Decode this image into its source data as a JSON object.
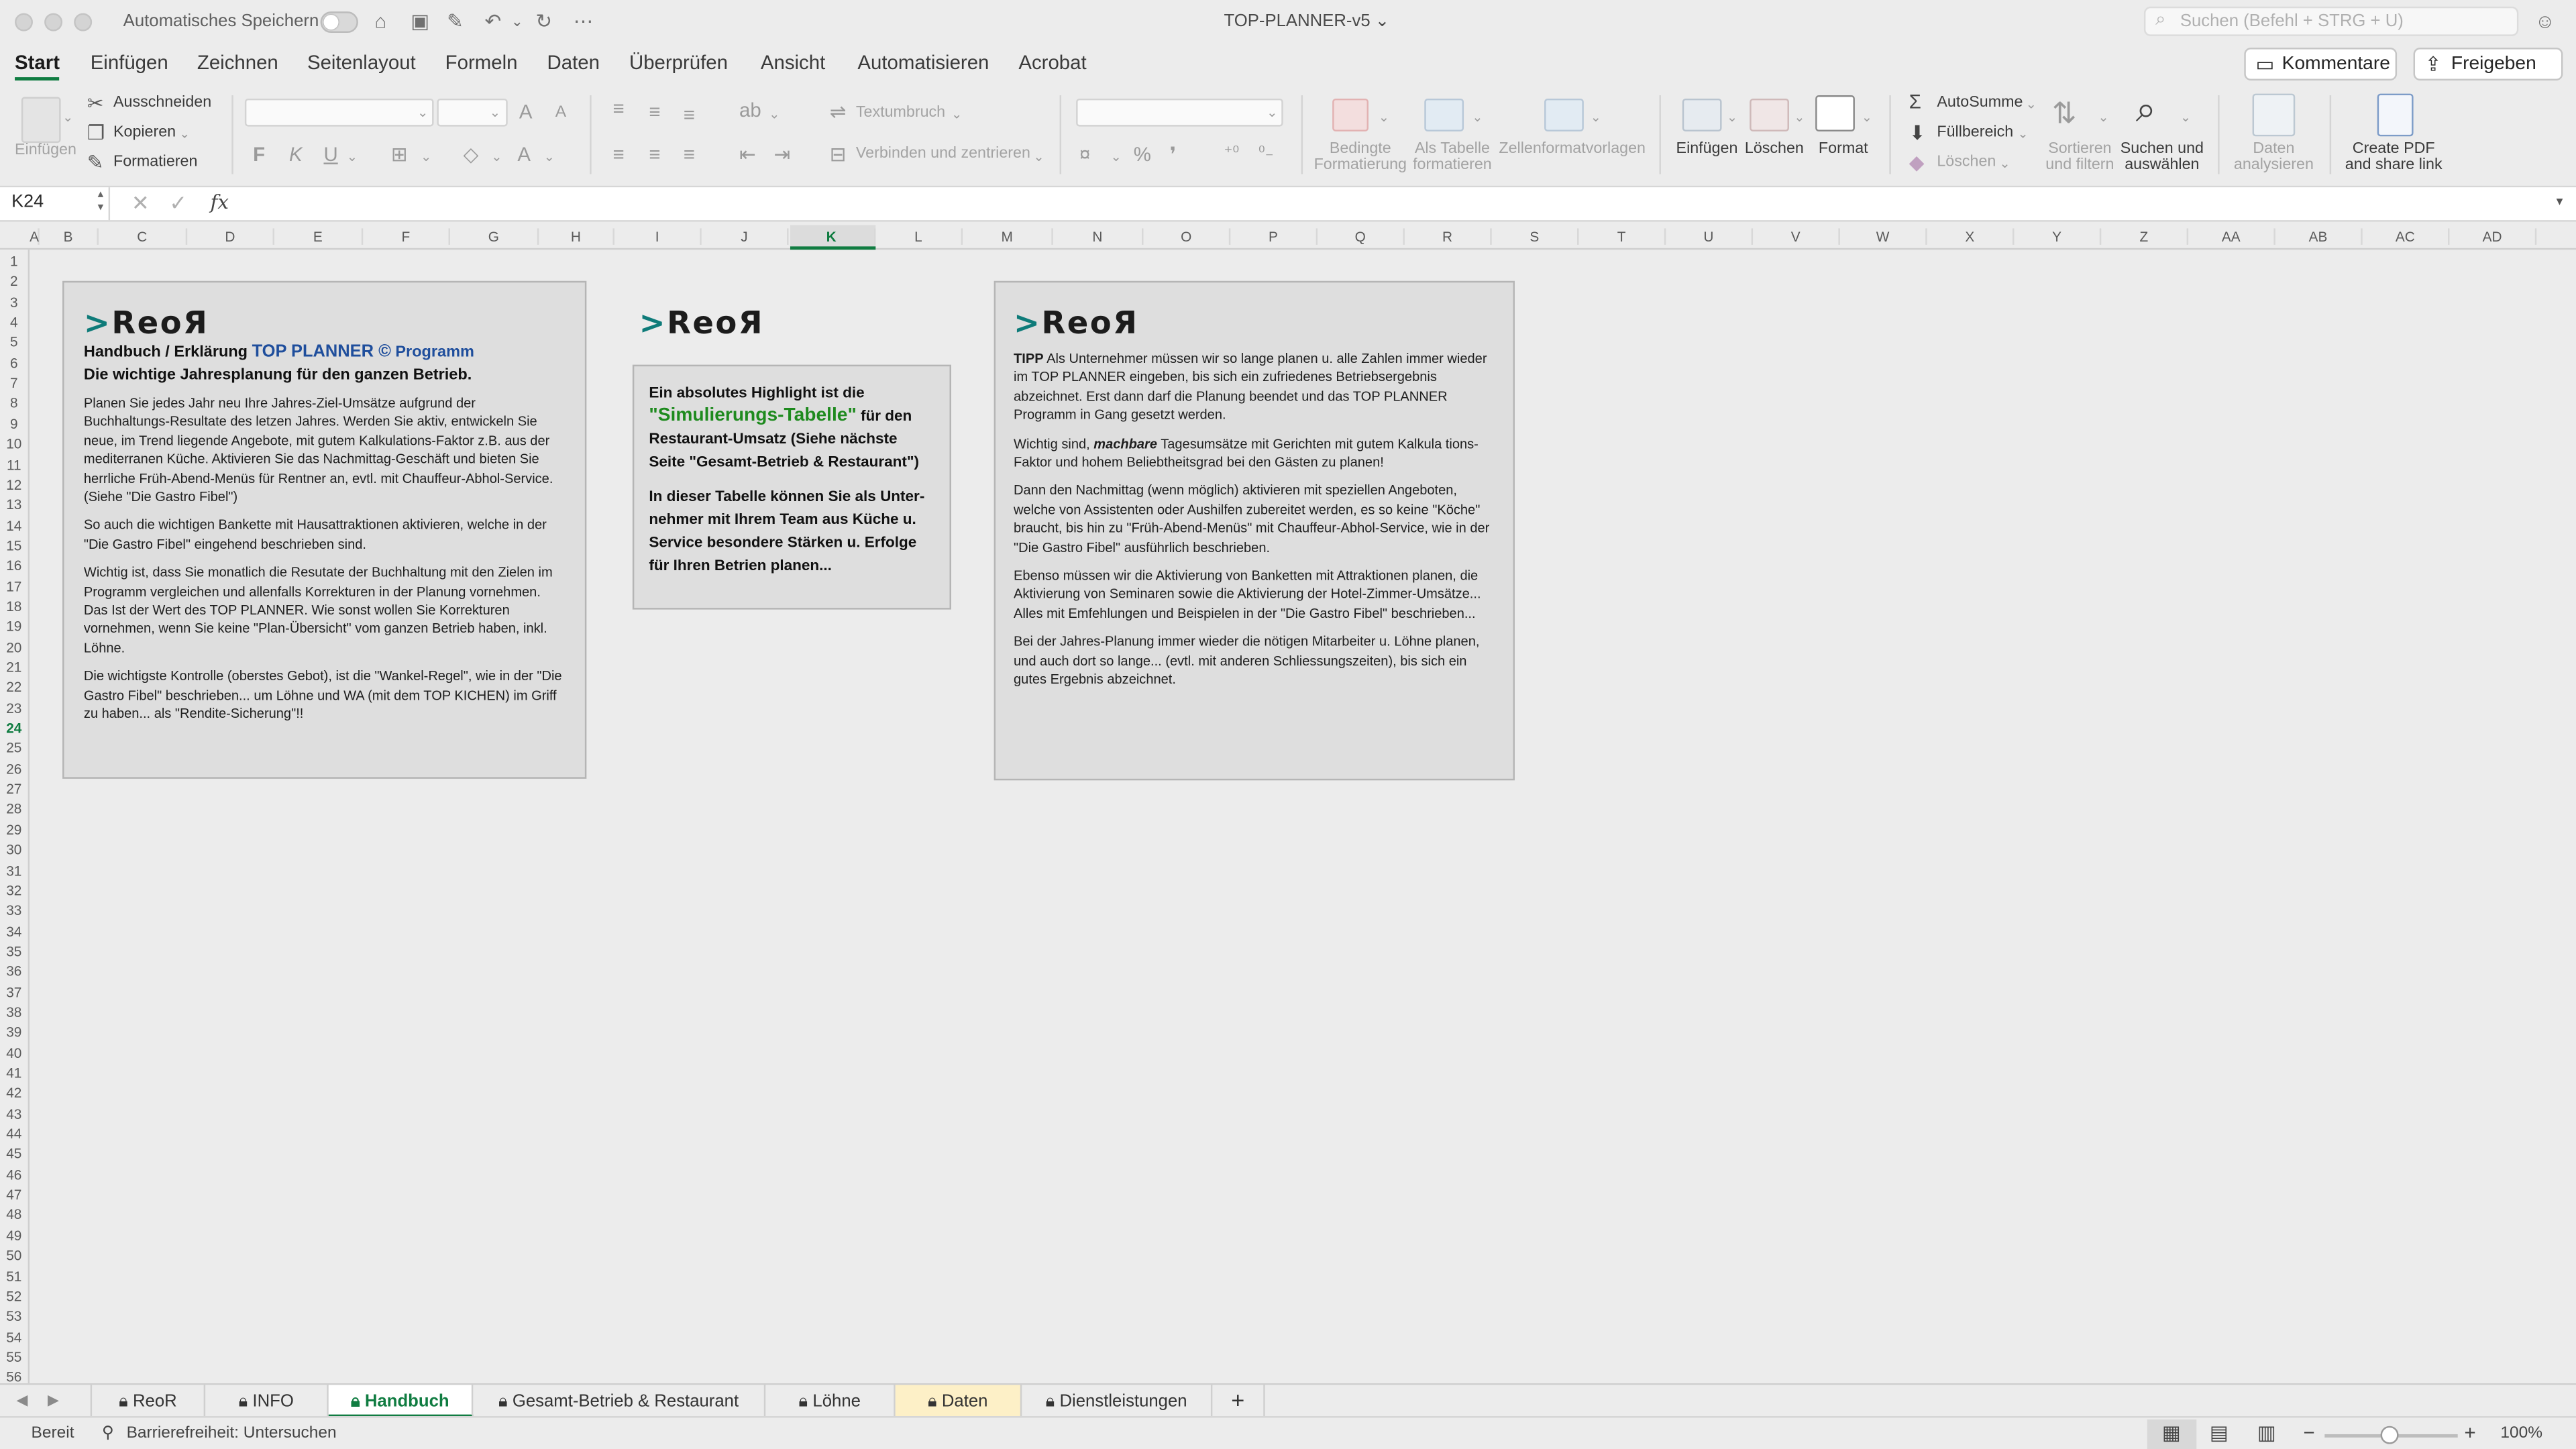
{
  "titlebar": {
    "autosave_label": "Automatisches Speichern",
    "doc_title": "TOP-PLANNER-v5",
    "search_placeholder": "Suchen (Befehl + STRG + U)"
  },
  "tabs": [
    "Start",
    "Einfügen",
    "Zeichnen",
    "Seitenlayout",
    "Formeln",
    "Daten",
    "Überprüfen",
    "Ansicht",
    "Automatisieren",
    "Acrobat"
  ],
  "header_buttons": {
    "comments": "Kommentare",
    "share": "Freigeben"
  },
  "ribbon": {
    "paste": "Einfügen",
    "cut": "Ausschneiden",
    "copy": "Kopieren",
    "format_painter": "Formatieren",
    "bold": "F",
    "italic": "K",
    "underline": "U",
    "wrap_text": "Textumbruch",
    "merge_center": "Verbinden und zentrieren",
    "cond_format_1": "Bedingte",
    "cond_format_2": "Formatierung",
    "as_table_1": "Als Tabelle",
    "as_table_2": "formatieren",
    "cell_styles": "Zellenformatvorlagen",
    "insert": "Einfügen",
    "delete": "Löschen",
    "format": "Format",
    "autosum": "AutoSumme",
    "fill": "Füllbereich",
    "clear": "Löschen",
    "sort_filter_1": "Sortieren",
    "sort_filter_2": "und filtern",
    "find_select_1": "Suchen und",
    "find_select_2": "auswählen",
    "analyze_1": "Daten",
    "analyze_2": "analysieren",
    "pdf_1": "Create PDF",
    "pdf_2": "and share link"
  },
  "formula_bar": {
    "cell_ref": "K24",
    "fx": "fx",
    "value": ""
  },
  "columns": [
    "A",
    "B",
    "C",
    "D",
    "E",
    "F",
    "G",
    "H",
    "I",
    "J",
    "K",
    "L",
    "M",
    "N",
    "O",
    "P",
    "Q",
    "R",
    "S",
    "T",
    "U",
    "V",
    "W",
    "X",
    "Y",
    "Z",
    "AA",
    "AB",
    "AC",
    "AD"
  ],
  "selected_column": "K",
  "row_count": 56,
  "selected_row": 24,
  "box1": {
    "logo_gt": ">",
    "logo_text": "ReoЯ",
    "heading_prefix": "Handbuch / Erklärung ",
    "heading_brand": "TOP PLANNER ©",
    "heading_suffix": " Programm",
    "subheading": "Die wichtige Jahresplanung für den ganzen Betrieb.",
    "paragraphs": [
      "Planen Sie jedes Jahr neu Ihre Jahres-Ziel-Umsätze aufgrund der Buchhaltungs-Resultate des letzen Jahres. Werden Sie aktiv, entwickeln Sie neue, im Trend liegende Angebote, mit gutem Kalkulations-Faktor z.B. aus der mediterranen Küche. Aktivieren Sie das Nachmittag-Geschäft und bieten Sie herrliche Früh-Abend-Menüs für Rentner an, evtl. mit Chauffeur-Abhol-Service. (Siehe \"Die Gastro Fibel\")",
      "So auch die wichtigen Bankette mit Hausattraktionen aktivieren, welche in der \"Die Gastro Fibel\" eingehend beschrieben sind.",
      "Wichtig ist, dass Sie monatlich die Resutate der Buchhaltung mit den Zielen im Programm vergleichen und allenfalls Korrekturen in der Planung vornehmen. Das Ist der Wert des TOP PLANNER. Wie sonst wollen Sie Korrekturen vornehmen, wenn Sie keine \"Plan-Übersicht\" vom ganzen Betrieb haben, inkl. Löhne.",
      "Die wichtigste Kontrolle (oberstes Gebot), ist die \"Wankel-Regel\", wie in der \"Die Gastro Fibel\" beschrieben... um Löhne und WA (mit dem TOP KICHEN) im Griff zu haben... als \"Rendite-Sicherung\"!!"
    ]
  },
  "box2": {
    "logo_gt": ">",
    "logo_text": "ReoЯ",
    "line1": "Ein absolutes Highlight ist die",
    "highlight": "\"Simulierungs-Tabelle\"",
    "line2": " für den Restaurant-Umsatz (Siehe nächste Seite \"Gesamt-Betrieb & Restaurant\")",
    "line3": "In dieser Tabelle können Sie als Unter-nehmer mit Ihrem Team aus Küche u. Service besondere Stärken u. Erfolge für Ihren Betrien planen..."
  },
  "box3": {
    "logo_gt": ">",
    "logo_text": "ReoЯ",
    "tipp_label": "TIPP",
    "p1": " Als Unternehmer müssen wir so lange planen u. alle Zahlen immer wieder im TOP PLANNER eingeben, bis sich ein zufriedenes Betriebsergebnis abzeichnet. Erst dann darf die Planung beendet und das TOP PLANNER Programm in Gang gesetzt werden.",
    "p2_prefix": "Wichtig sind, ",
    "p2_em": "machbare",
    "p2_suffix": " Tagesumsätze mit Gerichten mit gutem Kalkula tions-Faktor und hohem Beliebtheitsgrad bei den Gästen zu planen!",
    "p3": "Dann den Nachmittag (wenn möglich) aktivieren mit speziellen Angeboten, welche von Assistenten oder Aushilfen zubereitet werden, es so keine \"Köche\" braucht, bis hin zu \"Früh-Abend-Menüs\" mit Chauffeur-Abhol-Service, wie in der \"Die Gastro Fibel\" ausführlich beschrieben.",
    "p4": "Ebenso müssen wir die Aktivierung von Banketten  mit Attraktionen planen, die Aktivierung von Seminaren sowie die Aktivierung der Hotel-Zimmer-Umsätze... Alles mit Emfehlungen und Beispielen in der \"Die Gastro Fibel\" beschrieben...",
    "p5": "Bei der Jahres-Planung immer wieder die nötigen Mitarbeiter u. Löhne planen, und auch dort so lange... (evtl. mit anderen Schliessungszeiten), bis sich ein gutes Ergebnis abzeichnet."
  },
  "sheet_tabs": [
    "ReoR",
    "INFO",
    "Handbuch",
    "Gesamt-Betrieb & Restaurant",
    "Löhne",
    "Daten",
    "Dienstleistungen"
  ],
  "active_sheet": "Handbuch",
  "add_sheet": "+",
  "status": {
    "ready": "Bereit",
    "accessibility": "Barrierefreiheit: Untersuchen",
    "zoom": "100%"
  },
  "accent_color": "#107c41"
}
